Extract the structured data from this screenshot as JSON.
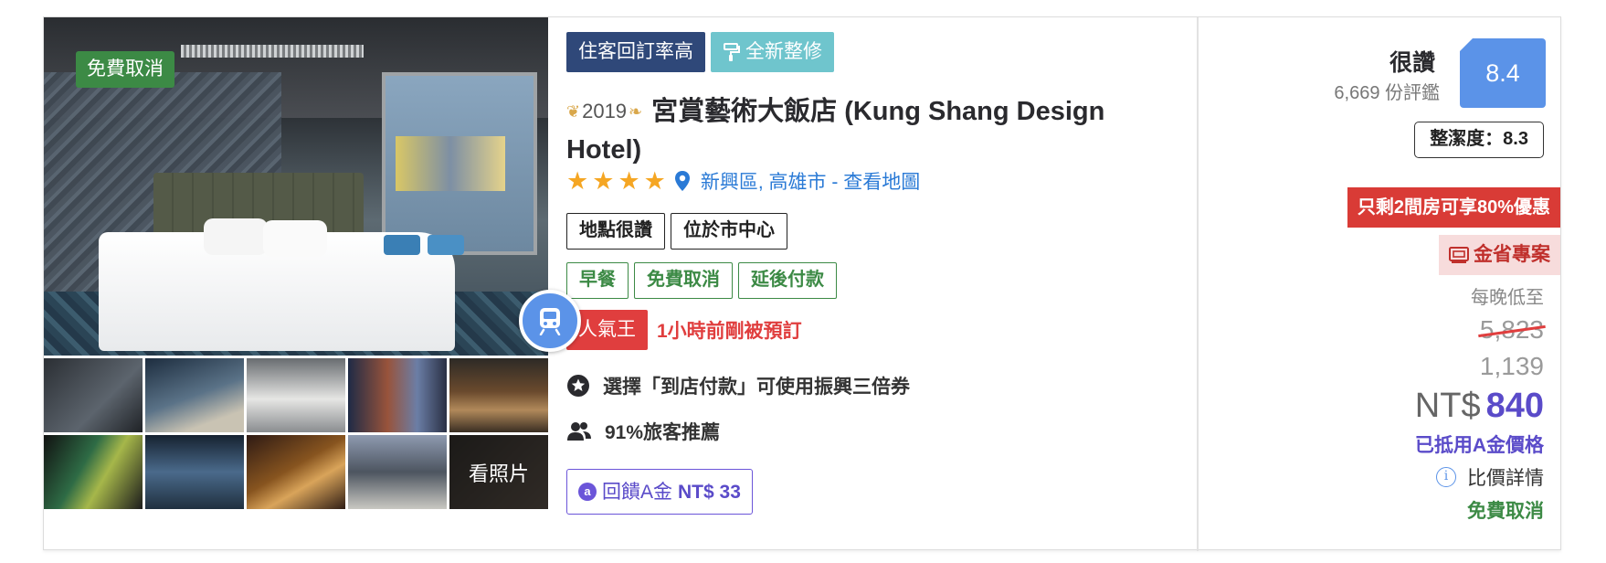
{
  "photo": {
    "free_cancel_badge": "免費取消",
    "more_photos_label": "看照片",
    "metro_icon": "metro-train-icon"
  },
  "info": {
    "badges": [
      "住客回訂率高",
      "全新整修"
    ],
    "renovated_icon": "paint-roller-icon",
    "award_year": "2019",
    "hotel_name": "宮賞藝術大飯店 (Kung Shang Design Hotel)",
    "star_rating": 4,
    "location_icon": "map-pin-icon",
    "location": "新興區, 高雄市 - 查看地圖",
    "tags_black": [
      "地點很讚",
      "位於市中心"
    ],
    "tags_green": [
      "早餐",
      "免費取消",
      "延後付款"
    ],
    "popular_badge": "人氣王",
    "popular_text": "1小時前剛被預訂",
    "feature_1": "選擇「到店付款」可使用振興三倍券",
    "feature_1_icon": "star-circle-icon",
    "feature_2": "91%旅客推薦",
    "feature_2_icon": "users-icon",
    "cashback_prefix": "回饋A金",
    "cashback_amount": "NT$ 33"
  },
  "price": {
    "rating_word": "很讚",
    "review_count": "6,669 份評鑑",
    "score": "8.4",
    "cleanliness": "整潔度：8.3",
    "rooms_left": "只剩2間房可享80%優惠",
    "deal_label": "金省專案",
    "deal_icon": "ticket-icon",
    "per_night": "每晚低至",
    "original_price": "5,823",
    "intermediate_price": "1,139",
    "currency": "NT$",
    "final_price": "840",
    "credit_note": "已抵用A金價格",
    "compare_label": "比價詳情",
    "free_cancel": "免費取消"
  },
  "colors": {
    "green": "#3c8a45",
    "navy": "#2f4879",
    "teal": "#6fc5cd",
    "red": "#e03e3e",
    "blue": "#5b93e8",
    "purple": "#5a4bc9",
    "star": "#f5a623"
  }
}
